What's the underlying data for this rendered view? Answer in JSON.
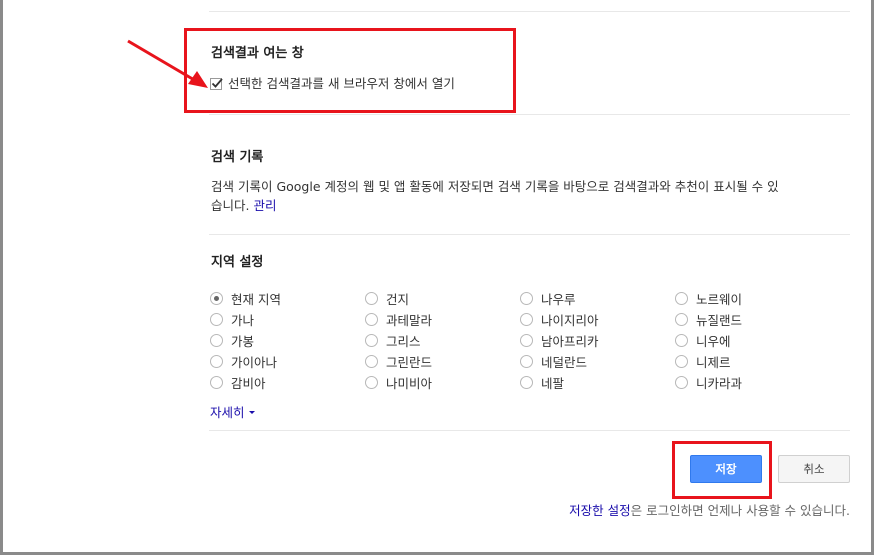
{
  "open_results": {
    "title": "검색결과 여는 창",
    "checkbox_label": "선택한 검색결과를 새 브라우저 창에서 열기",
    "checked": true
  },
  "search_history": {
    "title": "검색 기록",
    "description": "검색 기록이 Google 계정의 웹 및 앱 활동에 저장되면 검색 기록을 바탕으로 검색결과와 추천이 표시될 수 있습니다.",
    "line1": "검색 기록이 Google 계정의 웹 및 앱 활동에 저장되면 검색 기록을 바탕으로 검색결과와 추천이 표시될 수 있",
    "line2": "습니다.",
    "manage_link": "관리"
  },
  "region": {
    "title": "지역 설정",
    "selected": "현재 지역",
    "columns": [
      [
        "현재 지역",
        "가나",
        "가봉",
        "가이아나",
        "감비아"
      ],
      [
        "건지",
        "과테말라",
        "그리스",
        "그린란드",
        "나미비아"
      ],
      [
        "나우루",
        "나이지리아",
        "남아프리카",
        "네덜란드",
        "네팔"
      ],
      [
        "노르웨이",
        "뉴질랜드",
        "니우에",
        "니제르",
        "니카라과"
      ]
    ],
    "more_label": "자세히"
  },
  "actions": {
    "save_label": "저장",
    "cancel_label": "취소"
  },
  "footer": {
    "saved_settings_link": "저장한 설정",
    "note_rest": "은 로그인하면 언제나 사용할 수 있습니다."
  },
  "annotations": {
    "highlight_color": "#e8141c"
  }
}
